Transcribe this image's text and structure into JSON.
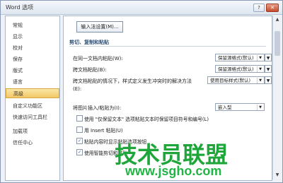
{
  "window": {
    "title": "Word 选项",
    "help": "?",
    "close": "✕"
  },
  "sidebar": {
    "items": [
      {
        "label": "常规"
      },
      {
        "label": "显示"
      },
      {
        "label": "校对"
      },
      {
        "label": "保存"
      },
      {
        "label": "版式"
      },
      {
        "label": "语言"
      },
      {
        "label": "高级"
      },
      {
        "label": "自定义功能区"
      },
      {
        "label": "快速访问工具栏"
      },
      {
        "label": "加载项"
      },
      {
        "label": "信任中心"
      }
    ]
  },
  "content": {
    "ime_button": "输入法设置(M)...",
    "section_title": "剪切、复制和粘贴",
    "rows": [
      {
        "label": "在同一文档内粘贴(W):",
        "value": "保留源格式(默认)"
      },
      {
        "label": "跨文档粘贴(B):",
        "value": "保留源格式(默认)"
      },
      {
        "label": "跨文档粘贴的情况下，样式定义发生冲突时的解决方法",
        "value": "使用目标样式(默认)"
      },
      {
        "label": "(E):",
        "value": ""
      },
      {
        "label": "将图片插入/粘贴为(I):",
        "value": "嵌入型"
      }
    ],
    "checks": [
      {
        "label": "使用 \"仅保留文本\" 选项粘贴文本时保留项目符号和编号(L)",
        "checked": false
      },
      {
        "label": "用 Insert 粘贴(U)",
        "checked": false
      },
      {
        "label": "粘贴内容时显示粘贴选项按钮",
        "checked": true
      },
      {
        "label": "使用智能剪切和粘贴",
        "checked": true
      }
    ]
  },
  "watermark": {
    "main": "技术员联盟",
    "url": "www.jsgho.com"
  }
}
